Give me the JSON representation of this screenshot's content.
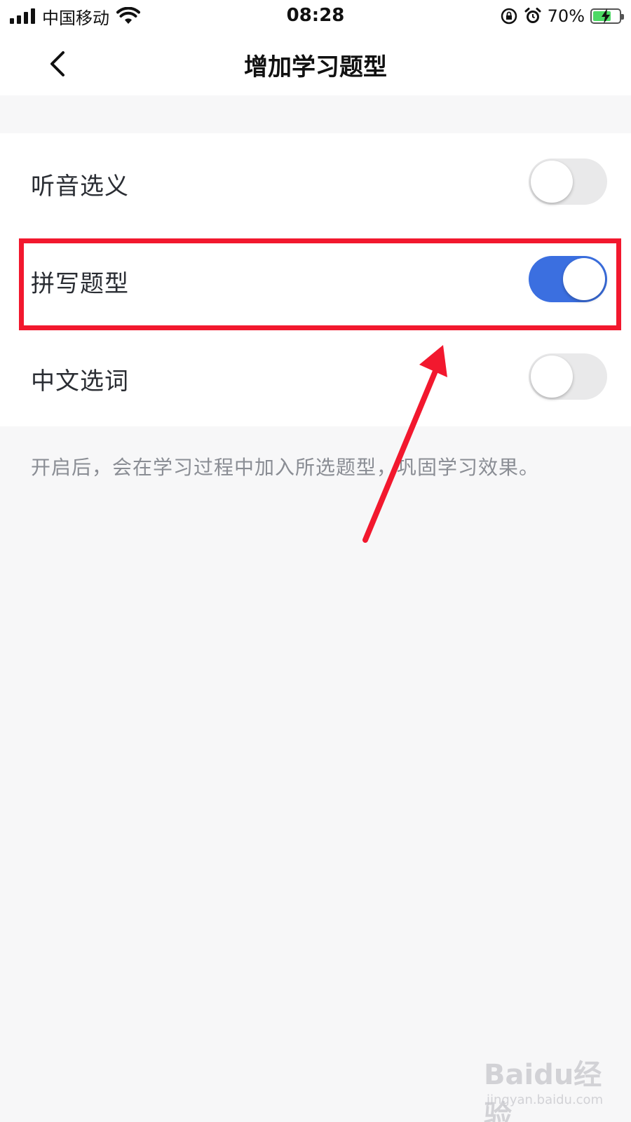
{
  "status_bar": {
    "carrier": "中国移动",
    "time": "08:28",
    "battery_percent": "70%",
    "battery_level": 0.7,
    "icons": [
      "signal-icon",
      "wifi-icon",
      "orientation-lock-icon",
      "alarm-icon",
      "battery-charging-icon"
    ]
  },
  "nav": {
    "title": "增加学习题型",
    "back_icon": "chevron-left-icon"
  },
  "settings": {
    "items": [
      {
        "label": "听音选义",
        "enabled": false
      },
      {
        "label": "拼写题型",
        "enabled": true
      },
      {
        "label": "中文选词",
        "enabled": false
      }
    ]
  },
  "hint": "开启后，会在学习过程中加入所选题型，巩固学习效果。",
  "annotation": {
    "color": "#f2182e",
    "highlighted_item": "拼写题型"
  },
  "watermark": {
    "logo_text": "Baidu经验",
    "url_text": "jingyan.baidu.com"
  },
  "colors": {
    "toggle_on": "#3b6fe0",
    "toggle_off": "#e9e9ea",
    "page_background": "#f7f7f8"
  }
}
